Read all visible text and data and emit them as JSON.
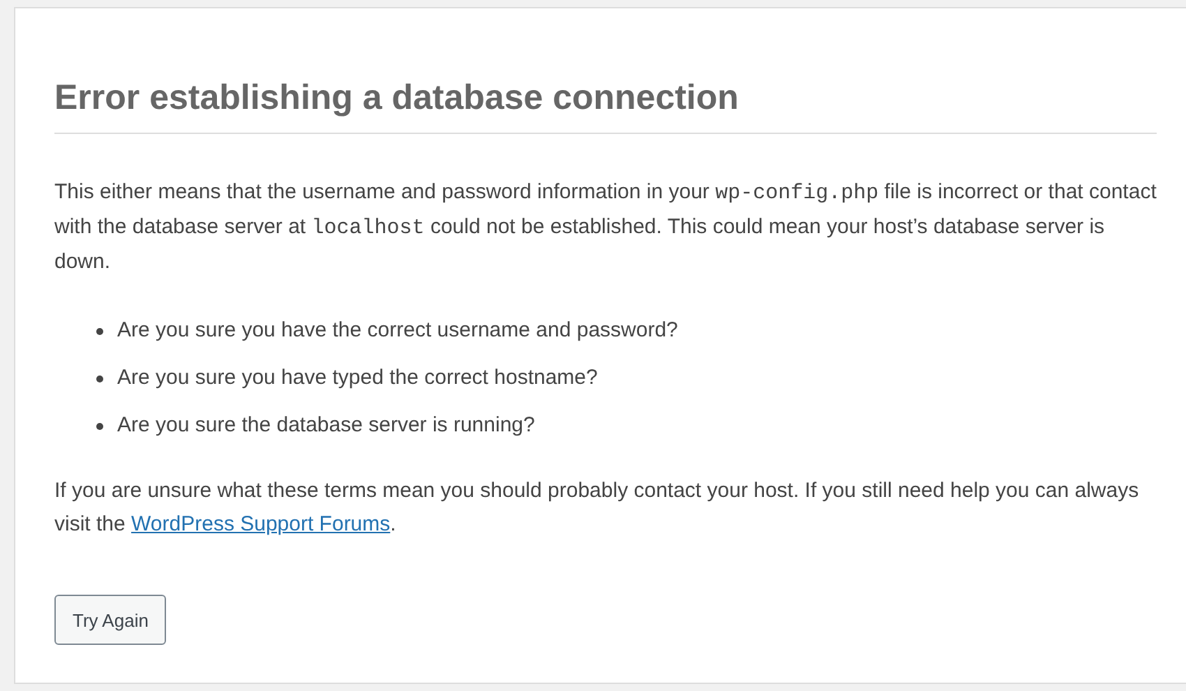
{
  "heading": "Error establishing a database connection",
  "intro": [
    {
      "kind": "text",
      "text": "This either means that the username and password information in your "
    },
    {
      "kind": "code",
      "text": "wp-config.php"
    },
    {
      "kind": "text",
      "text": " file is incorrect or that contact with the database server at "
    },
    {
      "kind": "code",
      "text": "localhost"
    },
    {
      "kind": "text",
      "text": " could not be established. This could mean your host’s database server is down."
    }
  ],
  "checks": [
    "Are you sure you have the correct username and password?",
    "Are you sure you have typed the correct hostname?",
    "Are you sure the database server is running?"
  ],
  "help": {
    "text": "If you are unsure what these terms mean you should probably contact your host. If you still need help you can always visit the ",
    "link": "WordPress Support Forums",
    "end": "."
  },
  "button": "Try Again"
}
